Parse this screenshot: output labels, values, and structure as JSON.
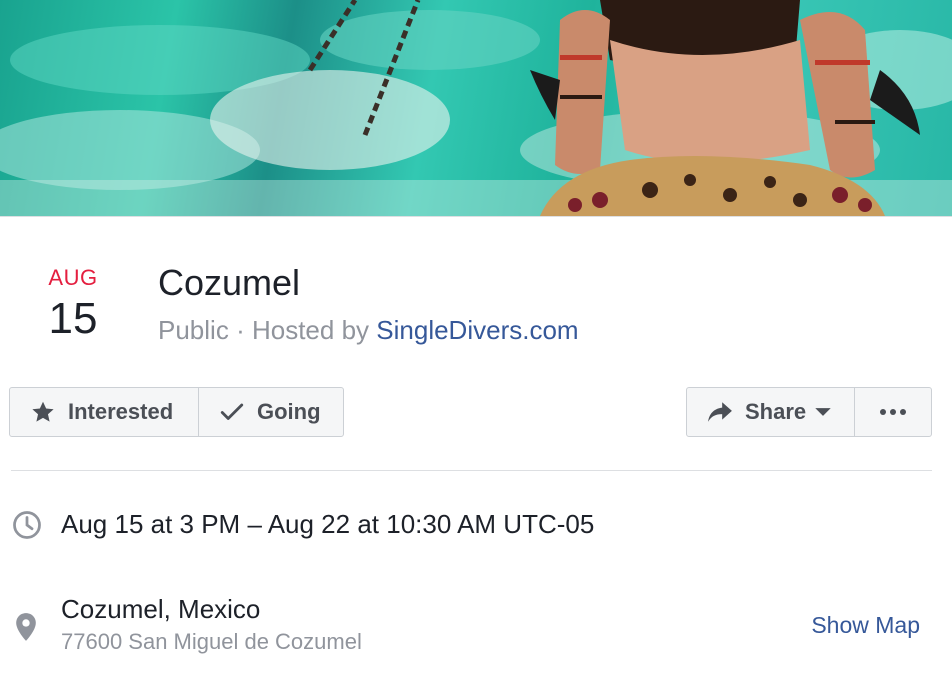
{
  "cover": {
    "description_icon": "cover-photo"
  },
  "date": {
    "month": "AUG",
    "day": "15"
  },
  "event": {
    "title": "Cozumel",
    "privacy": "Public",
    "hosted_by_prefix": "Hosted by",
    "separator": "·",
    "host": "SingleDivers.com"
  },
  "actions": {
    "interested_label": "Interested",
    "going_label": "Going",
    "share_label": "Share"
  },
  "details": {
    "time": "Aug 15 at 3 PM – Aug 22 at 10:30 AM UTC-05",
    "place_name": "Cozumel, Mexico",
    "place_address": "77600 San Miguel de Cozumel",
    "show_map_label": "Show Map"
  },
  "colors": {
    "month": "#e41e3f",
    "link": "#365899",
    "muted": "#90949c",
    "text": "#1d2129"
  }
}
